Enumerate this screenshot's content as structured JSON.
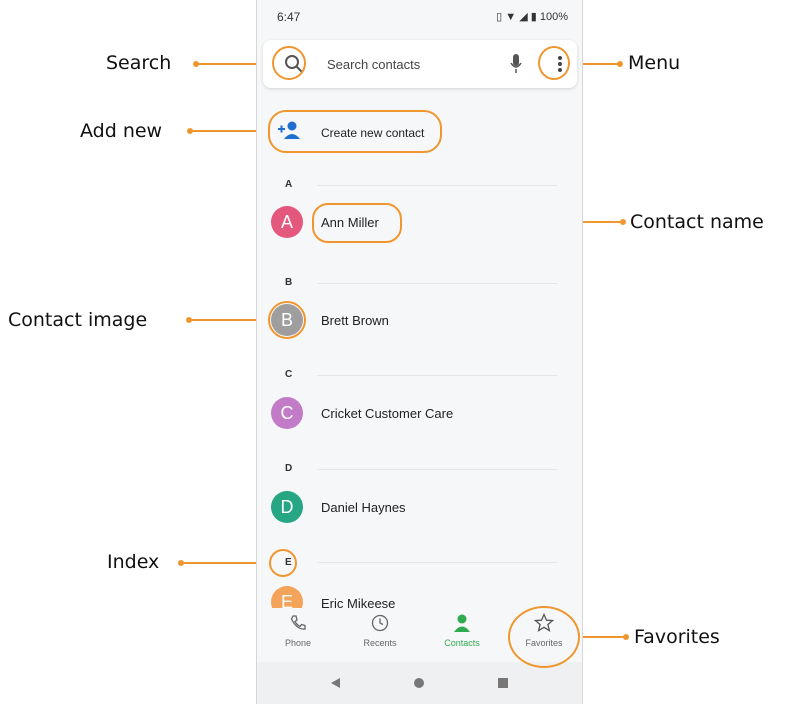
{
  "status": {
    "time": "6:47",
    "battery": "100%"
  },
  "search": {
    "placeholder": "Search contacts"
  },
  "actions": {
    "create_label": "Create new contact"
  },
  "sections": [
    {
      "letter": "A",
      "contact": {
        "initial": "A",
        "name": "Ann Miller",
        "color": "#e5587e"
      }
    },
    {
      "letter": "B",
      "contact": {
        "initial": "B",
        "name": "Brett Brown",
        "color": "#9e9e9e"
      }
    },
    {
      "letter": "C",
      "contact": {
        "initial": "C",
        "name": "Cricket Customer Care",
        "color": "#c27bc6"
      }
    },
    {
      "letter": "D",
      "contact": {
        "initial": "D",
        "name": "Daniel Haynes",
        "color": "#26a683"
      }
    },
    {
      "letter": "E",
      "contact": {
        "initial": "E",
        "name": "Eric Mikeese",
        "color": "#f4a45a"
      }
    }
  ],
  "nav": {
    "phone": "Phone",
    "recents": "Recents",
    "contacts": "Contacts",
    "favorites": "Favorites",
    "active_color": "#2eab4f"
  },
  "annotations": {
    "search": "Search",
    "menu": "Menu",
    "add_new": "Add new",
    "contact_name": "Contact name",
    "contact_image": "Contact image",
    "index": "Index",
    "favorites": "Favorites",
    "color": "#f0962e"
  }
}
